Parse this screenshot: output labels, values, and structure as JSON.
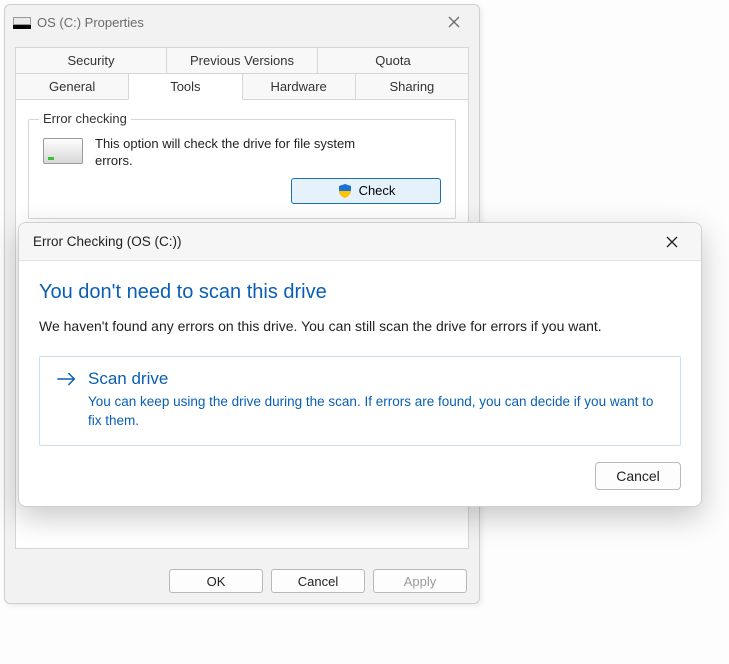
{
  "properties": {
    "title": "OS (C:) Properties",
    "tabs_row1": [
      "Security",
      "Previous Versions",
      "Quota"
    ],
    "tabs_row2": [
      "General",
      "Tools",
      "Hardware",
      "Sharing"
    ],
    "selected_tab": "Tools",
    "error_checking": {
      "group_label": "Error checking",
      "description": "This option will check the drive for file system errors.",
      "check_button": "Check"
    },
    "footer": {
      "ok": "OK",
      "cancel": "Cancel",
      "apply": "Apply"
    }
  },
  "modal": {
    "title": "Error Checking (OS (C:))",
    "heading": "You don't need to scan this drive",
    "body": "We haven't found any errors on this drive. You can still scan the drive for errors if you want.",
    "command": {
      "title": "Scan drive",
      "description": "You can keep using the drive during the scan. If errors are found, you can decide if you want to fix them."
    },
    "cancel": "Cancel"
  }
}
